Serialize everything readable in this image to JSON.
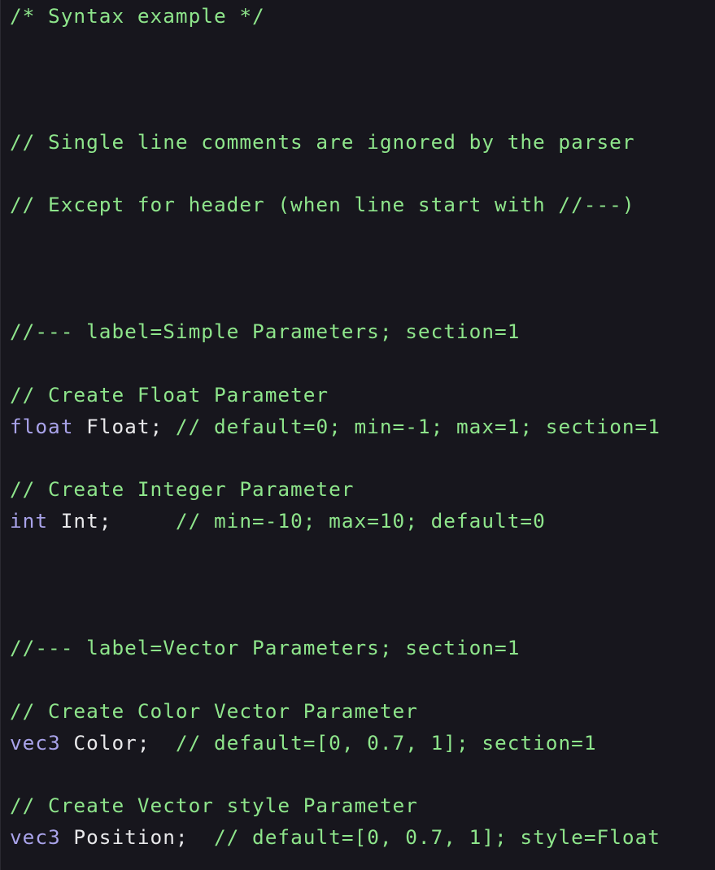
{
  "colors": {
    "background": "#17161d",
    "comment": "#8ee58b",
    "keyword": "#a9a3ea",
    "identifier": "#e8e8ea"
  },
  "code": {
    "block_comment": "/* Syntax example */",
    "comment_single_line": "// Single line comments are ignored by the parser",
    "comment_header_exception": "// Except for header (when line start with //---)",
    "header_simple": "//--- label=Simple Parameters; section=1",
    "comment_create_float": "// Create Float Parameter",
    "float_line": {
      "keyword": "float",
      "identifier": " Float;",
      "comment": " // default=0; min=-1; max=1; section=1"
    },
    "comment_create_integer": "// Create Integer Parameter",
    "int_line": {
      "keyword": "int",
      "identifier": " Int;",
      "comment": "     // min=-10; max=10; default=0"
    },
    "header_vector": "//--- label=Vector Parameters; section=1",
    "comment_create_color": "// Create Color Vector Parameter",
    "color_line": {
      "keyword": "vec3",
      "identifier": " Color;",
      "comment": "  // default=[0, 0.7, 1]; section=1"
    },
    "comment_create_vector_style": "// Create Vector style Parameter",
    "position_line": {
      "keyword": "vec3",
      "identifier": " Position;",
      "comment": "  // default=[0, 0.7, 1]; style=Float"
    }
  }
}
